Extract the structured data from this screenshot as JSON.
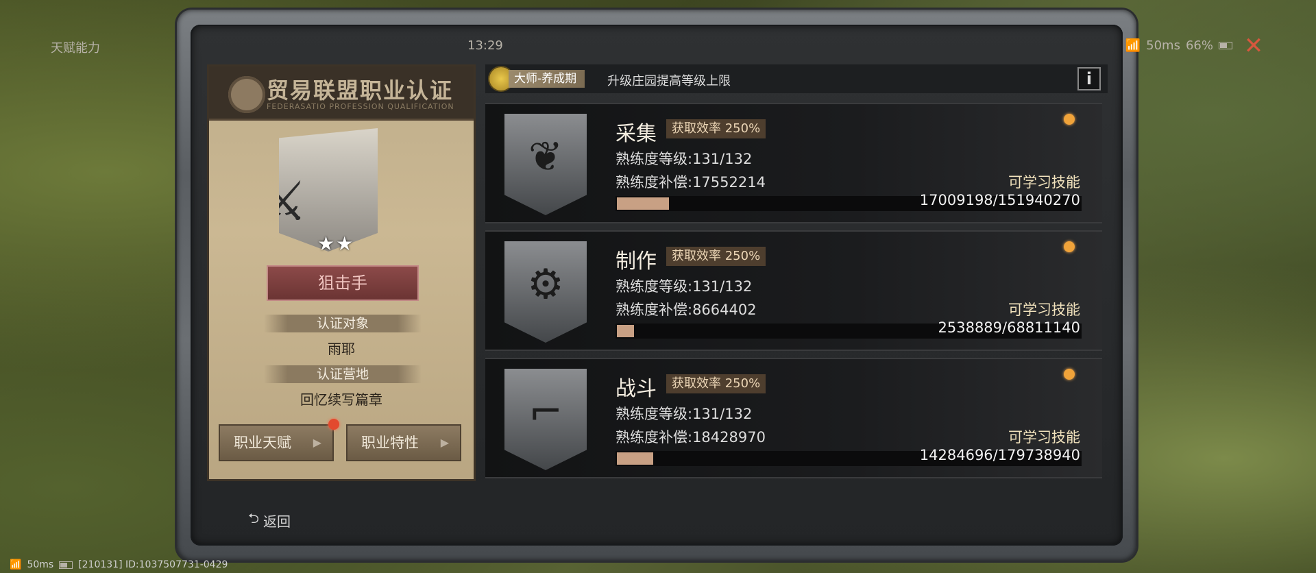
{
  "window": {
    "title": "天赋能力",
    "time": "13:29",
    "ping": "50ms",
    "battery": "66%"
  },
  "certificate": {
    "title": "贸易联盟职业认证",
    "subtitle": "FEDERASATIO PROFESSION QUALIFICATION",
    "rank_name": "狙击手",
    "stars": "★★",
    "label_target": "认证对象",
    "target_value": "雨耶",
    "label_camp": "认证营地",
    "camp_value": "回忆续写篇章",
    "btn_talent": "职业天赋",
    "btn_trait": "职业特性"
  },
  "rank_bar": {
    "badge": "大师-养成期",
    "text": "升级庄园提高等级上限",
    "info": "i"
  },
  "skills": [
    {
      "name": "采集",
      "efficiency": "获取效率 250%",
      "level_line": "熟练度等级:131/132",
      "comp_line": "熟练度补偿:17552214",
      "learn": "可学习技能",
      "progress": "17009198/151940270",
      "ratio": 0.112
    },
    {
      "name": "制作",
      "efficiency": "获取效率 250%",
      "level_line": "熟练度等级:131/132",
      "comp_line": "熟练度补偿:8664402",
      "learn": "可学习技能",
      "progress": "2538889/68811140",
      "ratio": 0.037
    },
    {
      "name": "战斗",
      "efficiency": "获取效率 250%",
      "level_line": "熟练度等级:131/132",
      "comp_line": "熟练度补偿:18428970",
      "learn": "可学习技能",
      "progress": "14284696/179738940",
      "ratio": 0.079
    }
  ],
  "back_label": "返回",
  "system": {
    "ping": "50ms",
    "id_line": "[210131] ID:1037507731-0429"
  },
  "colors": {
    "accent": "#c8a084",
    "alert_dot": "#f0a33a",
    "rank_red": "#8c4a49"
  }
}
